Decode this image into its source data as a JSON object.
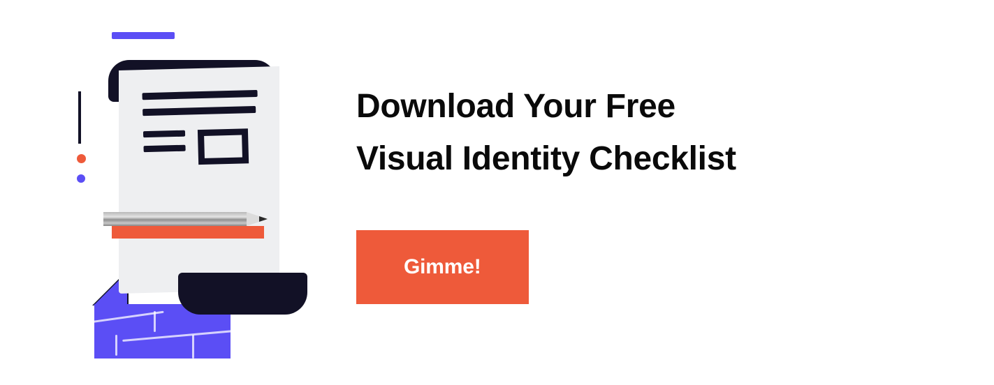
{
  "content": {
    "heading_line1": "Download Your Free",
    "heading_line2": "Visual Identity Checklist",
    "button_label": "Gimme!"
  },
  "colors": {
    "accent_orange": "#ee5a3a",
    "accent_purple": "#5b4ef5",
    "dark": "#121126",
    "paper": "#eeeff1"
  },
  "illustration": {
    "name": "checklist-paper-with-pencil"
  }
}
